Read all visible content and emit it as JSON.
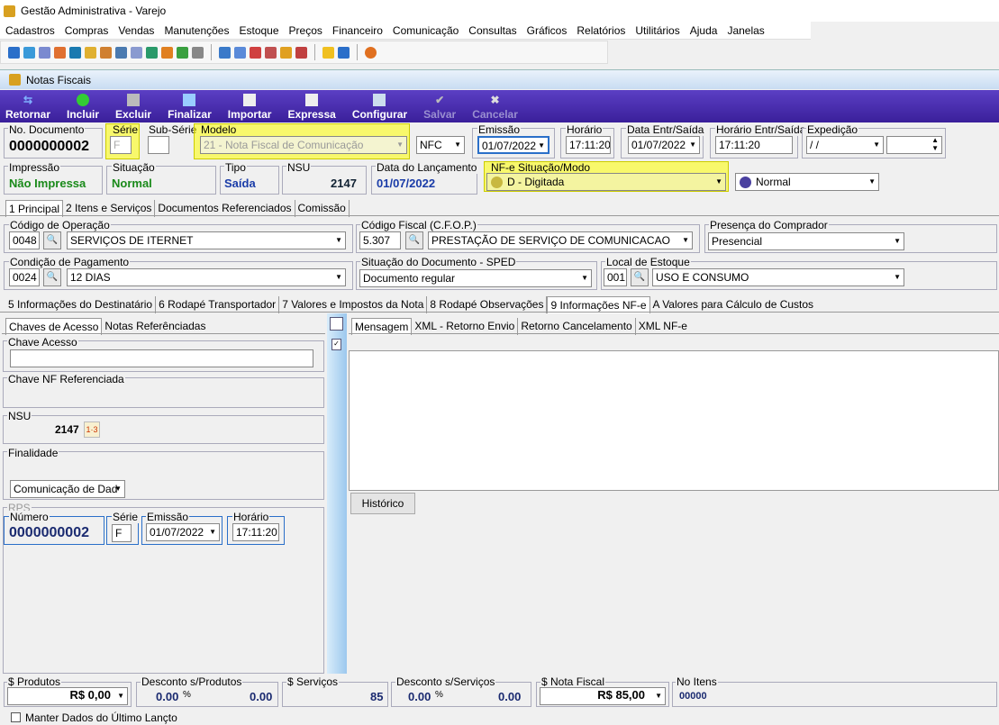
{
  "app": {
    "title": "Gestão Administrativa - Varejo"
  },
  "menu": [
    "Cadastros",
    "Compras",
    "Vendas",
    "Manutenções",
    "Estoque",
    "Preços",
    "Financeiro",
    "Comunicação",
    "Consultas",
    "Gráficos",
    "Relatórios",
    "Utilitários",
    "Ajuda",
    "Janelas"
  ],
  "window": {
    "title": "Notas Fiscais"
  },
  "toolbar": {
    "retornar": "Retornar",
    "incluir": "Incluir",
    "excluir": "Excluir",
    "finalizar": "Finalizar",
    "importar": "Importar",
    "expressa": "Expressa",
    "configurar": "Configurar",
    "salvar": "Salvar",
    "cancelar": "Cancelar"
  },
  "header": {
    "no_doc_label": "No. Documento",
    "no_doc": "0000000002",
    "serie_label": "Série",
    "serie": "F",
    "subserie_label": "Sub-Série",
    "subserie": "",
    "modelo_label": "Modelo",
    "modelo": "21 - Nota Fiscal de Comunicação",
    "modelo_type": "NFC",
    "emissao_label": "Emissão",
    "emissao": "01/07/2022",
    "horario_label": "Horário",
    "horario": "17:11:20",
    "data_entr_label": "Data Entr/Saída",
    "data_entr": "01/07/2022",
    "horario_entr_label": "Horário Entr/Saída",
    "horario_entr": "17:11:20",
    "expedicao_label": "Expedição",
    "expedicao": " /  /"
  },
  "status": {
    "impressao_label": "Impressão",
    "impressao": "Não Impressa",
    "situacao_label": "Situação",
    "situacao": "Normal",
    "tipo_label": "Tipo",
    "tipo": "Saída",
    "nsu_label": "NSU",
    "nsu": "2147",
    "data_lanc_label": "Data do Lançamento",
    "data_lanc": "01/07/2022",
    "nfe_label": "NF-e Situação/Modo",
    "nfe": "D - Digitada",
    "modo": "Normal"
  },
  "main_tabs": [
    "1 Principal",
    "2 Itens e Serviços",
    "Documentos Referenciados",
    "Comissão"
  ],
  "principal": {
    "cod_op_label": "Código de Operação",
    "cod_op": "0048",
    "cod_op_desc": "SERVIÇOS DE ITERNET",
    "cfop_label": "Código Fiscal (C.F.O.P.)",
    "cfop": "5.307",
    "cfop_desc": "PRESTAÇÃO DE SERVIÇO DE COMUNICACAO",
    "presenca_label": "Presença do Comprador",
    "presenca": "Presencial",
    "cond_pag_label": "Condição de Pagamento",
    "cond_pag": "0024",
    "cond_pag_desc": "12 DIAS",
    "sit_doc_label": "Situação do Documento - SPED",
    "sit_doc": "Documento regular",
    "local_label": "Local de Estoque",
    "local": "001",
    "local_desc": "USO E CONSUMO"
  },
  "sub_tabs": [
    "5 Informações do Destinatário",
    "6 Rodapé Transportador",
    "7 Valores e Impostos da Nota",
    "8 Rodapé Observações",
    "9 Informações NF-e",
    "A Valores para Cálculo de Custos"
  ],
  "left_tabs": [
    "Chaves de Acesso",
    "Notas Referênciadas"
  ],
  "chaves": {
    "chave_label": "Chave Acesso",
    "chave_nf_label": "Chave NF Referenciada",
    "nsu_label": "NSU",
    "nsu": "2147",
    "finalidade_label": "Finalidade",
    "finalidade": "Comunicação de Dad",
    "rps_label": "RPS",
    "numero_label": "Número",
    "numero": "0000000002",
    "serie_label": "Série",
    "serie": "F",
    "emissao_label": "Emissão",
    "emissao": "01/07/2022",
    "horario_label": "Horário",
    "horario": "17:11:20"
  },
  "right_tabs": [
    "Mensagem",
    "XML - Retorno Envio",
    "Retorno Cancelamento",
    "XML NF-e"
  ],
  "historico": "Histórico",
  "totals": {
    "produtos_label": "$ Produtos",
    "produtos": "R$ 0,00",
    "desc_prod_label": "Desconto s/Produtos",
    "desc_prod_pct": "0.00",
    "desc_prod": "0.00",
    "servicos_label": "$ Serviços",
    "servicos": "85",
    "desc_serv_label": "Desconto s/Serviços",
    "desc_serv_pct": "0.00",
    "desc_serv": "0.00",
    "nota_label": "$ Nota Fiscal",
    "nota": "R$ 85,00",
    "itens_label": "No Itens",
    "itens": "00000"
  },
  "manter": "Manter Dados do Último Lançto"
}
